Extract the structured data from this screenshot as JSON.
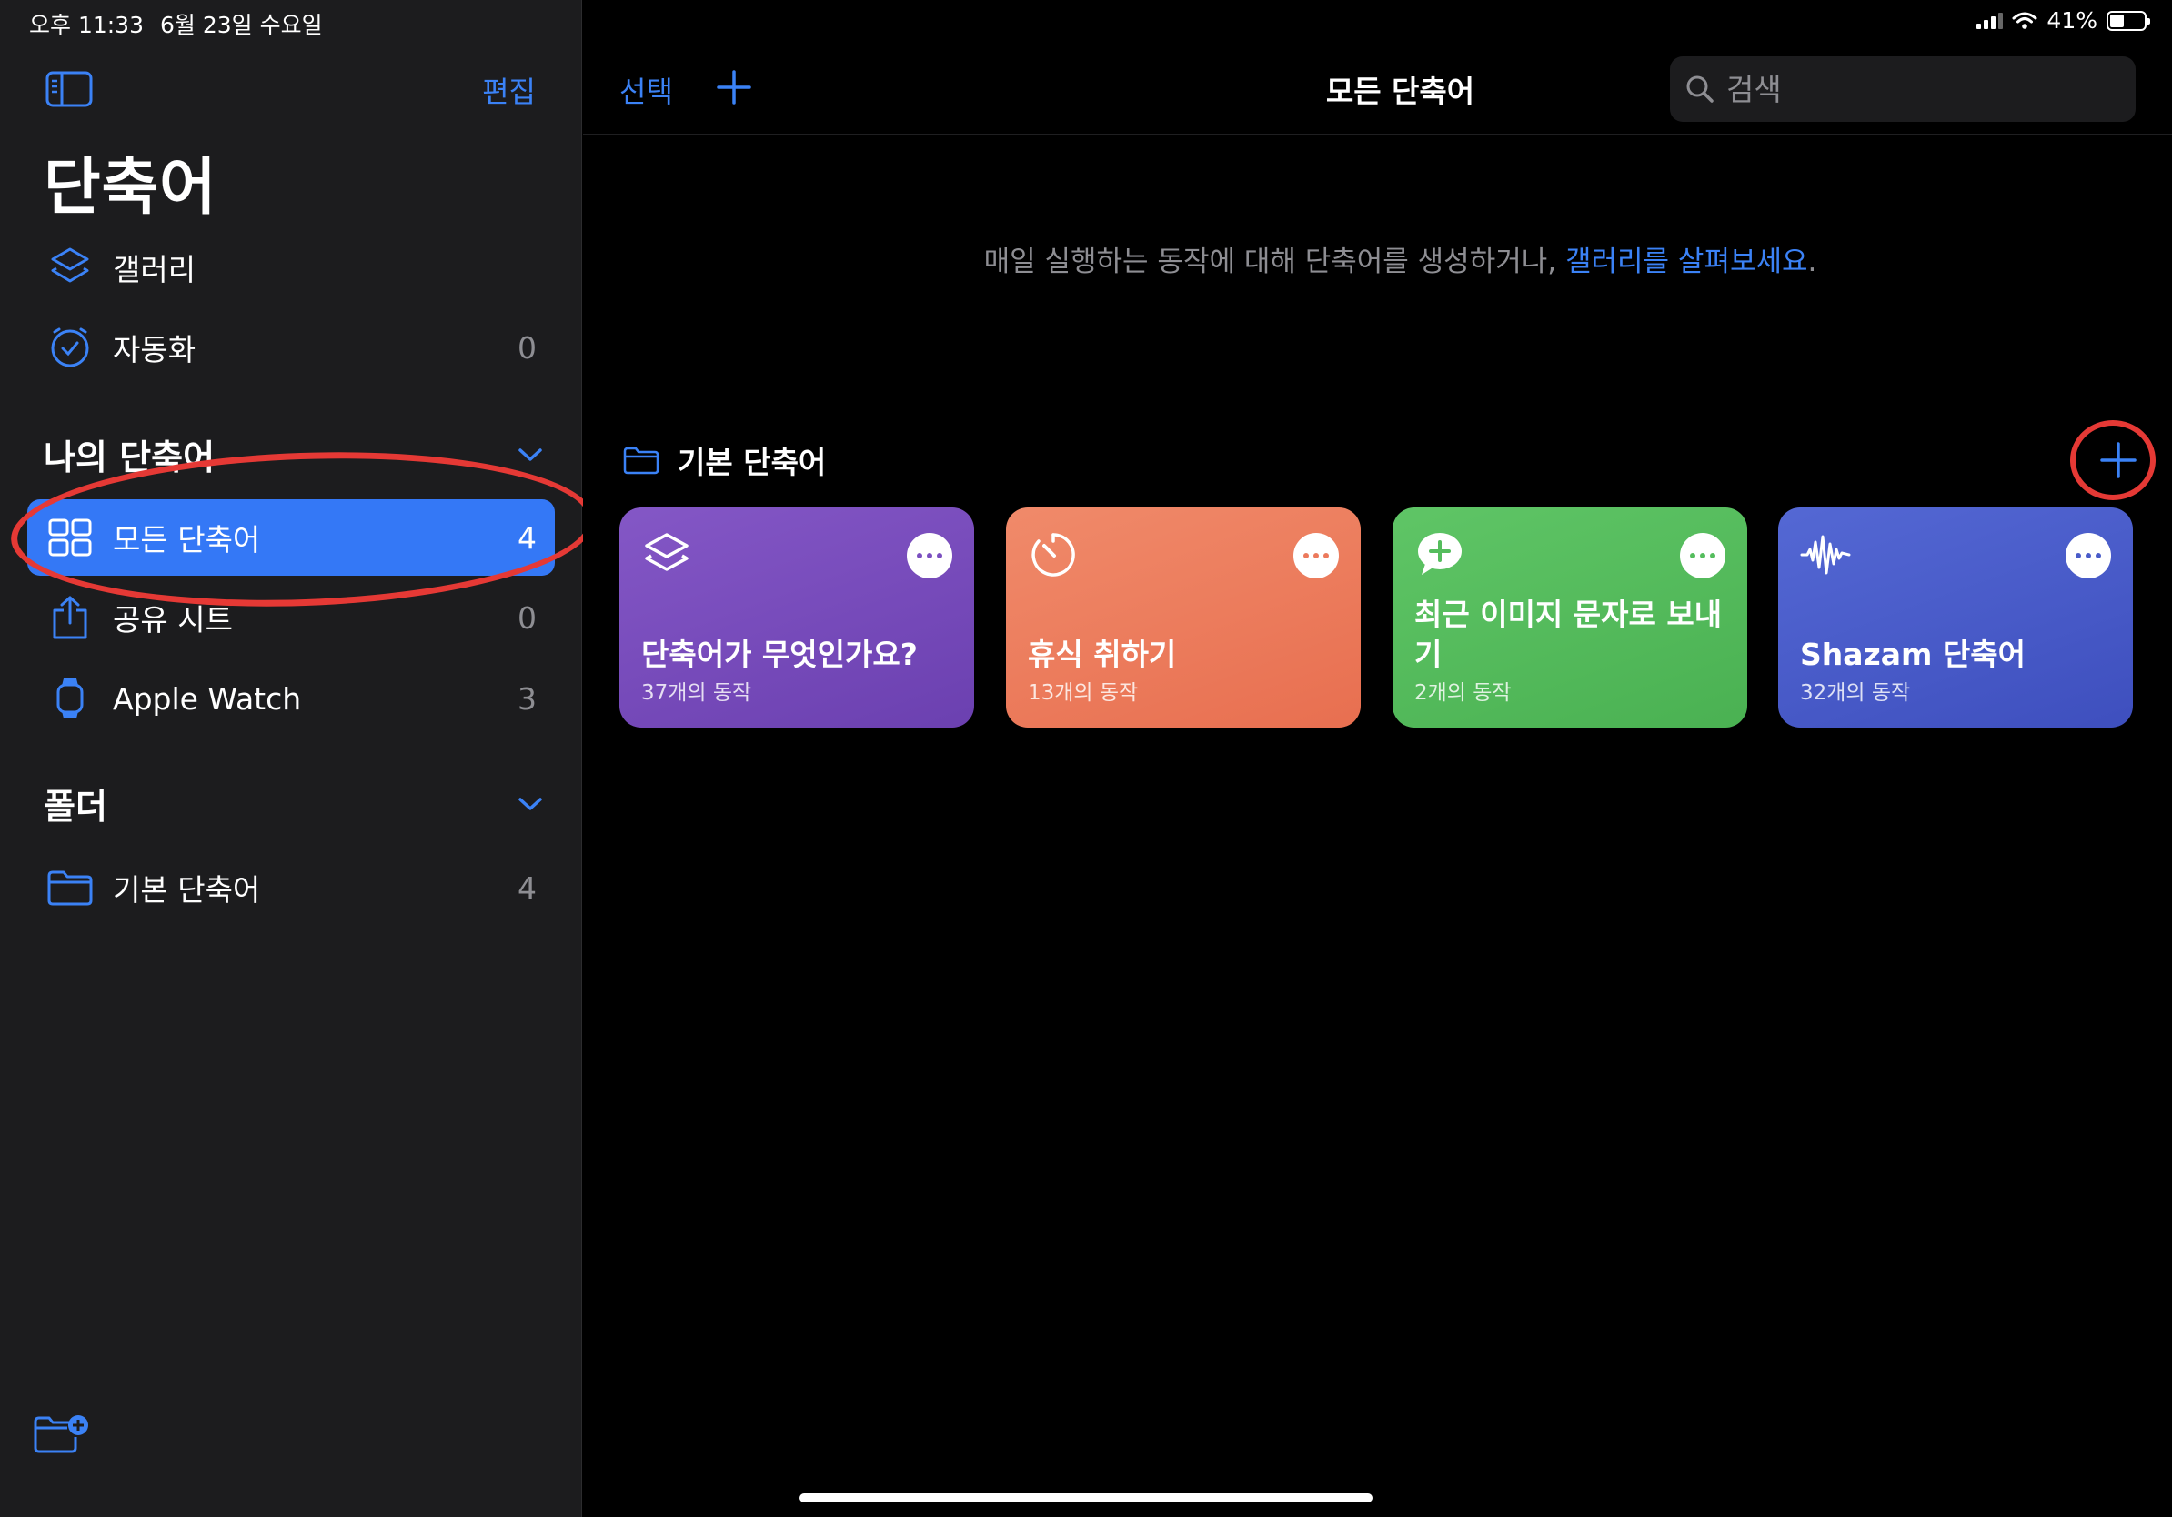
{
  "status_bar": {
    "time": "오후 11:33",
    "date": "6월 23일 수요일",
    "battery": "41%",
    "battery_level": 0.41
  },
  "sidebar": {
    "edit_label": "편집",
    "app_title": "단축어",
    "top_items": [
      {
        "label": "갤러리",
        "icon": "layers-icon"
      },
      {
        "label": "자동화",
        "count": "0",
        "icon": "clock-icon"
      }
    ],
    "my_shortcuts": {
      "title": "나의 단축어",
      "items": [
        {
          "label": "모든 단축어",
          "count": "4",
          "icon": "grid-icon",
          "selected": true
        },
        {
          "label": "공유 시트",
          "count": "0",
          "icon": "share-icon"
        },
        {
          "label": "Apple Watch",
          "count": "3",
          "icon": "watch-icon"
        }
      ]
    },
    "folders": {
      "title": "폴더",
      "items": [
        {
          "label": "기본 단축어",
          "count": "4",
          "icon": "folder-icon"
        }
      ]
    }
  },
  "main": {
    "select_label": "선택",
    "nav_title": "모든 단축어",
    "search_placeholder": "검색",
    "intro_text": "매일 실행하는 동작에 대해 단축어를 생성하거나, ",
    "intro_link": "갤러리를 살펴보세요",
    "intro_end": ".",
    "folder": {
      "title": "기본 단축어",
      "shortcuts": [
        {
          "title": "단축어가 무엇인가요?",
          "subtitle": "37개의 동작",
          "color": "#7b4fc0",
          "icon": "layers-icon"
        },
        {
          "title": "휴식 취하기",
          "subtitle": "13개의 동작",
          "color": "#ec7a5c",
          "icon": "timer-icon"
        },
        {
          "title": "최근 이미지 문자로 보내기",
          "subtitle": "2개의 동작",
          "color": "#55bd5d",
          "icon": "message-plus-icon"
        },
        {
          "title": "Shazam 단축어",
          "subtitle": "32개의 동작",
          "color": "#4a5cc9",
          "icon": "waveform-icon"
        }
      ]
    }
  },
  "colors": {
    "accent": "#3b82f6",
    "annotation": "#e53935"
  }
}
